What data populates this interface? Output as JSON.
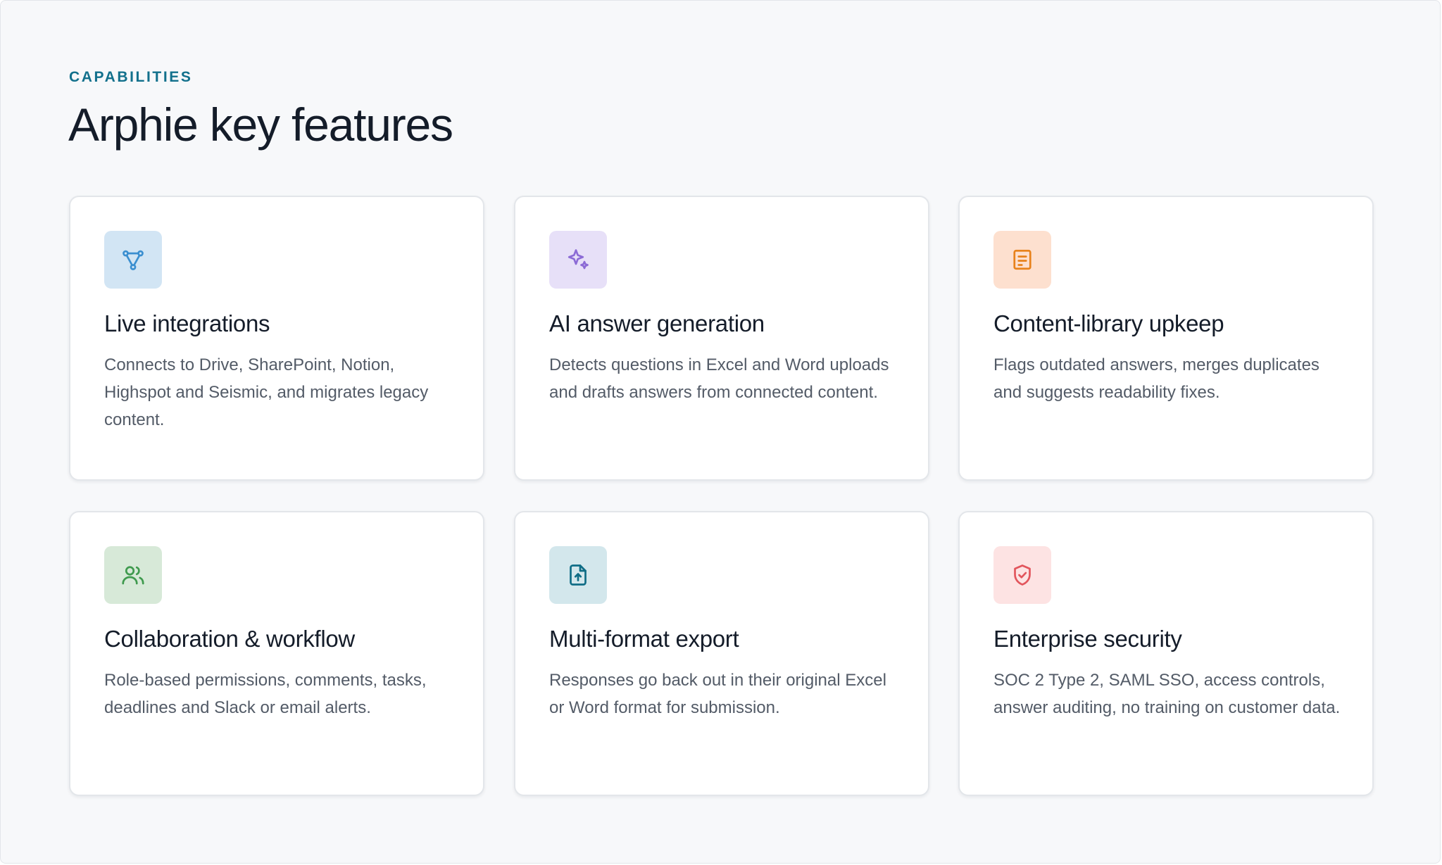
{
  "section": {
    "eyebrow": "CAPABILITIES",
    "title": "Arphie key features"
  },
  "colors": {
    "eyebrow": "#12708c",
    "title": "#141c29"
  },
  "features": [
    {
      "title": "Live integrations",
      "description": "Connects to Drive, SharePoint, Notion, Highspot and Seismic, and migrates legacy content.",
      "icon": "integration-nodes-icon",
      "tile_color": "#d2e5f4",
      "icon_color": "#3b8fd0"
    },
    {
      "title": "AI answer generation",
      "description": "Detects questions in Excel and Word uploads and drafts answers from connected content.",
      "icon": "sparkles-icon",
      "tile_color": "#e7e0f8",
      "icon_color": "#8c6bd6"
    },
    {
      "title": "Content-library upkeep",
      "description": "Flags outdated answers, merges duplicates and suggests readability fixes.",
      "icon": "document-icon",
      "tile_color": "#fde0cf",
      "icon_color": "#e8821c"
    },
    {
      "title": "Collaboration & workflow",
      "description": "Role-based permissions, comments, tasks, deadlines and Slack or email alerts.",
      "icon": "users-icon",
      "tile_color": "#d7e9d8",
      "icon_color": "#3f9a4e"
    },
    {
      "title": "Multi-format export",
      "description": "Responses go back out in their original Excel or Word format for submission.",
      "icon": "file-upload-icon",
      "tile_color": "#d3e7ec",
      "icon_color": "#0f6d86"
    },
    {
      "title": "Enterprise security",
      "description": "SOC 2 Type 2, SAML SSO, access controls, answer auditing, no training on customer data.",
      "icon": "shield-check-icon",
      "tile_color": "#fde3e3",
      "icon_color": "#e2555c"
    }
  ]
}
